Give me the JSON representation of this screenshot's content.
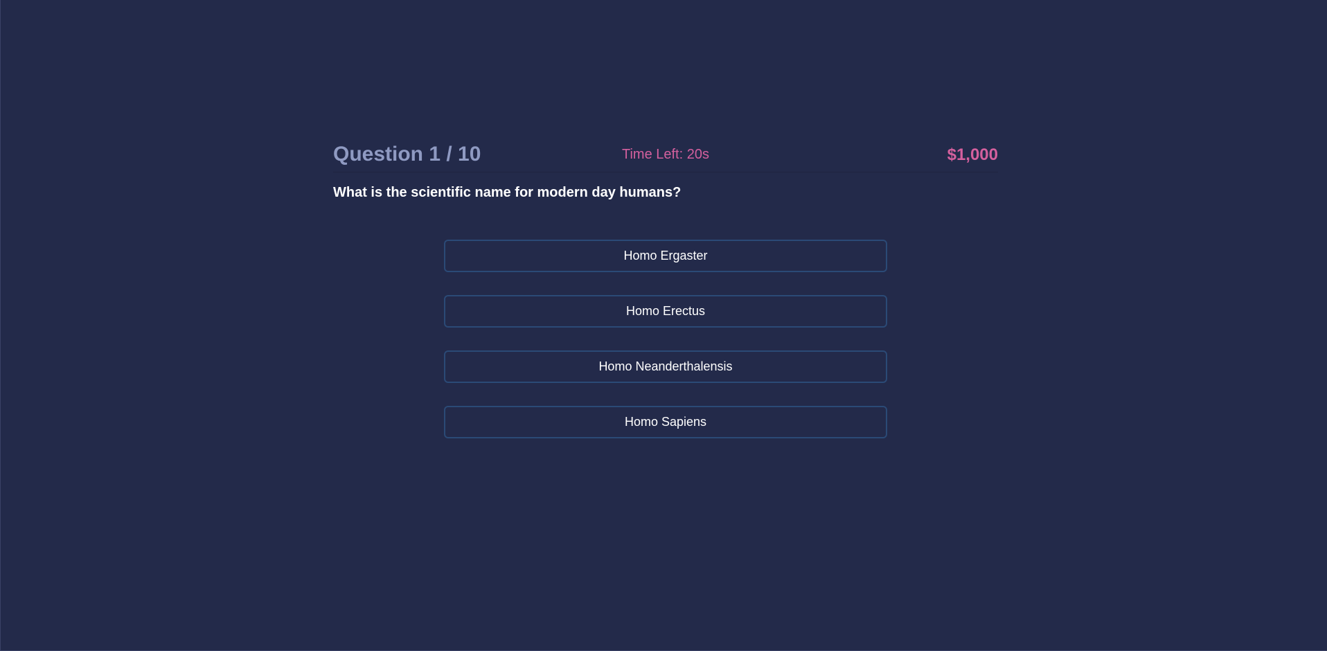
{
  "header": {
    "question_counter": "Question 1 / 10",
    "timer": "Time Left: 20s",
    "prize": "$1,000"
  },
  "question": {
    "text": "What is the scientific name for modern day humans?"
  },
  "answers": [
    {
      "label": "Homo Ergaster"
    },
    {
      "label": "Homo Erectus"
    },
    {
      "label": "Homo Neanderthalensis"
    },
    {
      "label": "Homo Sapiens"
    }
  ],
  "colors": {
    "background": "#232a4a",
    "counter": "#8f9ac2",
    "accent": "#d4609e",
    "button_border": "#2b4a76"
  }
}
